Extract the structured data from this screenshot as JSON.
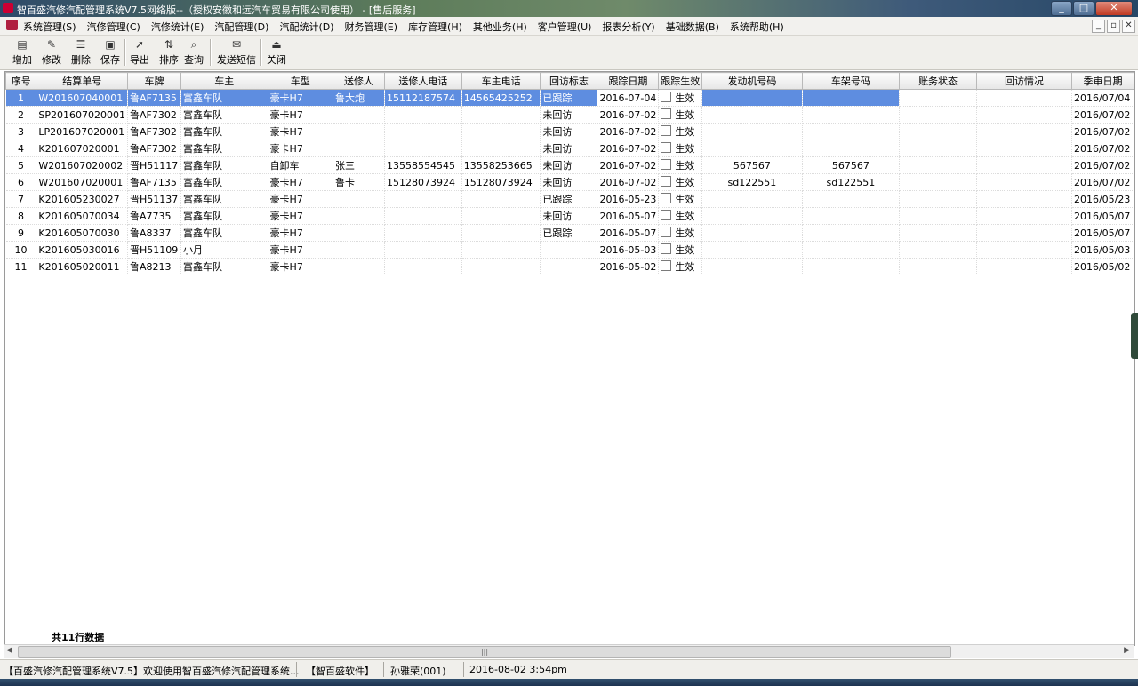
{
  "window": {
    "title": "智百盛汽修汽配管理系统V7.5网络版--（授权安徽和远汽车贸易有限公司使用） - [售后服务]"
  },
  "menu": [
    "系统管理(S)",
    "汽修管理(C)",
    "汽修统计(E)",
    "汽配管理(D)",
    "汽配统计(D)",
    "财务管理(E)",
    "库存管理(H)",
    "其他业务(H)",
    "客户管理(U)",
    "报表分析(Y)",
    "基础数据(B)",
    "系统帮助(H)"
  ],
  "toolbar": {
    "add": "增加",
    "edit": "修改",
    "delete": "删除",
    "save": "保存",
    "export": "导出",
    "sort": "排序",
    "query": "查询",
    "sms": "发送短信",
    "close": "关闭"
  },
  "columns": [
    "序号",
    "结算单号",
    "车牌",
    "车主",
    "车型",
    "送修人",
    "送修人电话",
    "车主电话",
    "回访标志",
    "跟踪日期",
    "跟踪生效",
    "发动机号码",
    "车架号码",
    "账务状态",
    "回访情况",
    "季审日期"
  ],
  "rows": [
    [
      "1",
      "W201607040001",
      "鲁AF7135",
      "富鑫车队",
      "豪卡H7",
      "鲁大炮",
      "15112187574",
      "14565425252",
      "已跟踪",
      "2016-07-04",
      "生效",
      "",
      "",
      "",
      "",
      "2016/07/04"
    ],
    [
      "2",
      "SP201607020001",
      "鲁AF7302",
      "富鑫车队",
      "豪卡H7",
      "",
      "",
      "",
      "未回访",
      "2016-07-02",
      "生效",
      "",
      "",
      "",
      "",
      "2016/07/02"
    ],
    [
      "3",
      "LP201607020001",
      "鲁AF7302",
      "富鑫车队",
      "豪卡H7",
      "",
      "",
      "",
      "未回访",
      "2016-07-02",
      "生效",
      "",
      "",
      "",
      "",
      "2016/07/02"
    ],
    [
      "4",
      "K201607020001",
      "鲁AF7302",
      "富鑫车队",
      "豪卡H7",
      "",
      "",
      "",
      "未回访",
      "2016-07-02",
      "生效",
      "",
      "",
      "",
      "",
      "2016/07/02"
    ],
    [
      "5",
      "W201607020002",
      "晋H51117",
      "富鑫车队",
      "自卸车",
      "张三",
      "13558554545",
      "13558253665",
      "未回访",
      "2016-07-02",
      "生效",
      "567567",
      "567567",
      "",
      "",
      "2016/07/02"
    ],
    [
      "6",
      "W201607020001",
      "鲁AF7135",
      "富鑫车队",
      "豪卡H7",
      "鲁卡",
      "15128073924",
      "15128073924",
      "未回访",
      "2016-07-02",
      "生效",
      "sd122551",
      "sd122551",
      "",
      "",
      "2016/07/02"
    ],
    [
      "7",
      "K201605230027",
      "晋H51137",
      "富鑫车队",
      "豪卡H7",
      "",
      "",
      "",
      "已跟踪",
      "2016-05-23",
      "生效",
      "",
      "",
      "",
      "",
      "2016/05/23"
    ],
    [
      "8",
      "K201605070034",
      "鲁A7735",
      "富鑫车队",
      "豪卡H7",
      "",
      "",
      "",
      "未回访",
      "2016-05-07",
      "生效",
      "",
      "",
      "",
      "",
      "2016/05/07"
    ],
    [
      "9",
      "K201605070030",
      "鲁A8337",
      "富鑫车队",
      "豪卡H7",
      "",
      "",
      "",
      "已跟踪",
      "2016-05-07",
      "生效",
      "",
      "",
      "",
      "",
      "2016/05/07"
    ],
    [
      "10",
      "K201605030016",
      "晋H51109",
      "小月",
      "豪卡H7",
      "",
      "",
      "",
      "",
      "2016-05-03",
      "生效",
      "",
      "",
      "",
      "",
      "2016/05/03"
    ],
    [
      "11",
      "K201605020011",
      "鲁A8213",
      "富鑫车队",
      "豪卡H7",
      "",
      "",
      "",
      "",
      "2016-05-02",
      "生效",
      "",
      "",
      "",
      "",
      "2016/05/02"
    ]
  ],
  "selected_row": 0,
  "footer": {
    "total": "共11行数据"
  },
  "status": {
    "welcome": "【百盛汽修汽配管理系统V7.5】欢迎使用智百盛汽修汽配管理系统...",
    "company": "【智百盛软件】",
    "user": "孙雅荣(001)",
    "datetime": "2016-08-02 3:54pm"
  },
  "colors": {
    "selection": "#5e8de0",
    "accent_red": "#c03a22"
  }
}
